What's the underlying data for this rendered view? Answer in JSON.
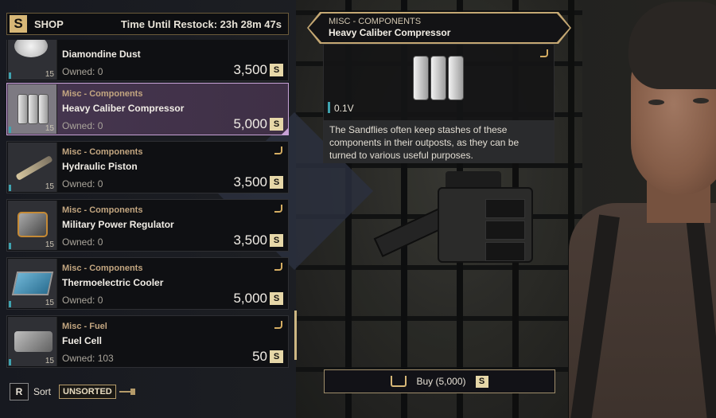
{
  "header": {
    "logo": "S",
    "title": "SHOP",
    "restock": "Time Until Restock: 23h 28m 47s"
  },
  "items": [
    {
      "category": "",
      "name": "Diamondine Dust",
      "owned": "Owned: 0",
      "price": "3,500",
      "quality": "15",
      "art": "dust-icon"
    },
    {
      "category": "Misc - Components",
      "name": "Heavy Caliber Compressor",
      "owned": "Owned: 0",
      "price": "5,000",
      "quality": "15",
      "art": "compressor-icon",
      "selected": true
    },
    {
      "category": "Misc - Components",
      "name": "Hydraulic Piston",
      "owned": "Owned: 0",
      "price": "3,500",
      "quality": "15",
      "art": "piston-icon"
    },
    {
      "category": "Misc - Components",
      "name": "Military Power Regulator",
      "owned": "Owned: 0",
      "price": "3,500",
      "quality": "15",
      "art": "regulator-icon"
    },
    {
      "category": "Misc - Components",
      "name": "Thermoelectric Cooler",
      "owned": "Owned: 0",
      "price": "5,000",
      "quality": "15",
      "art": "cooler-icon"
    },
    {
      "category": "Misc - Fuel",
      "name": "Fuel Cell",
      "owned": "Owned: 103",
      "price": "50",
      "quality": "15",
      "art": "fuel-cell-icon"
    }
  ],
  "currency_symbol": "S",
  "sort": {
    "key": "R",
    "label": "Sort",
    "mode": "UNSORTED"
  },
  "detail": {
    "category": "MISC - COMPONENTS",
    "name": "Heavy Caliber Compressor",
    "weight": "0.1V",
    "description": "The Sandflies often keep stashes of these components in their outposts, as they can be turned to various useful purposes."
  },
  "buy": {
    "label": "Buy (5,000)"
  },
  "colors": {
    "accent_gold": "#c5a873",
    "selected_bg": "#463650",
    "selected_border": "#c7a2d6",
    "quality_bar": "#3fa3b0"
  }
}
